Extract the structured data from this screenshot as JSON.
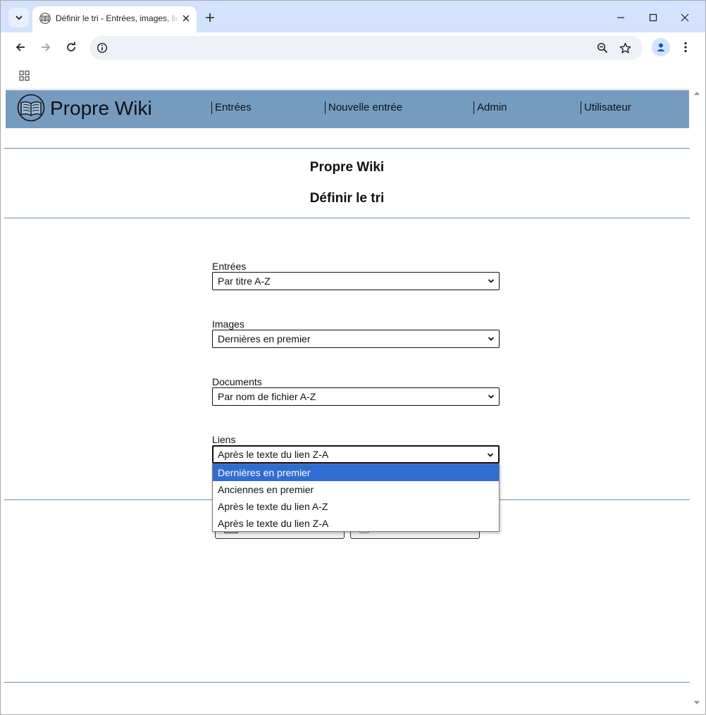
{
  "browser": {
    "tab_title": "Définir le tri - Entrées, images, liens",
    "address": ""
  },
  "site": {
    "name": "Propre Wiki",
    "nav": [
      "Entrées",
      "Nouvelle entrée",
      "Admin",
      "Utilisateur"
    ]
  },
  "page": {
    "title": "Propre Wiki",
    "subtitle": "Définir le tri"
  },
  "form": {
    "fields": [
      {
        "label": "Entrées",
        "value": "Par titre A-Z"
      },
      {
        "label": "Images",
        "value": "Dernières en premier"
      },
      {
        "label": "Documents",
        "value": "Par nom de fichier A-Z"
      },
      {
        "label": "Liens",
        "value": "Après le texte du lien Z-A"
      }
    ],
    "dropdown_options": [
      "Dernières en premier",
      "Anciennes en premier",
      "Après le texte du lien A-Z",
      "Après le texte du lien Z-A"
    ],
    "highlighted_option": "Dernières en premier"
  },
  "colors": {
    "header_bg": "#759cbf",
    "tabstrip_bg": "#d3e3fd",
    "highlight": "#2f6dd3",
    "rule": "#6a8ea8"
  }
}
